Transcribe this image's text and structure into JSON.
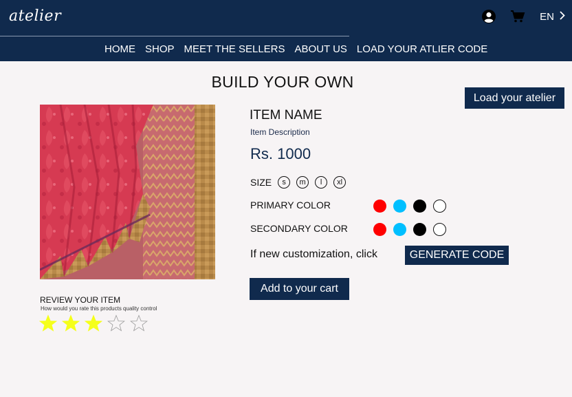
{
  "brand": {
    "logo_text": "atelier"
  },
  "header": {
    "language": "EN",
    "icons": [
      "account-icon",
      "cart-icon",
      "chevron-right-icon"
    ]
  },
  "nav": {
    "items": [
      {
        "label": "HOME"
      },
      {
        "label": "SHOP"
      },
      {
        "label": "MEET THE SELLERS"
      },
      {
        "label": "ABOUT US"
      },
      {
        "label": "LOAD YOUR ATLIER CODE"
      }
    ]
  },
  "page": {
    "title": "BUILD YOUR OWN",
    "load_button": "Load your atelier"
  },
  "product": {
    "name": "ITEM NAME",
    "description": "Item Description",
    "price": "Rs. 1000",
    "size_label": "SIZE",
    "sizes": [
      "s",
      "m",
      "l",
      "xl"
    ],
    "primary_color_label": "PRIMARY COLOR",
    "secondary_color_label": "SECONDARY COLOR",
    "colors": [
      "#ff0000",
      "#00bfff",
      "#000000",
      "#ffffff"
    ],
    "custom_text": "If new customization, click",
    "generate_button": "GENERATE CODE",
    "cart_button": "Add to your cart"
  },
  "review": {
    "title": "REVIEW YOUR ITEM",
    "subtitle": "How would you rate this products quality control",
    "rating": 3,
    "max": 5,
    "star_color": "#f5ff1a"
  },
  "colors": {
    "primary_navy": "#102a4d",
    "background": "#f7f4f5"
  }
}
